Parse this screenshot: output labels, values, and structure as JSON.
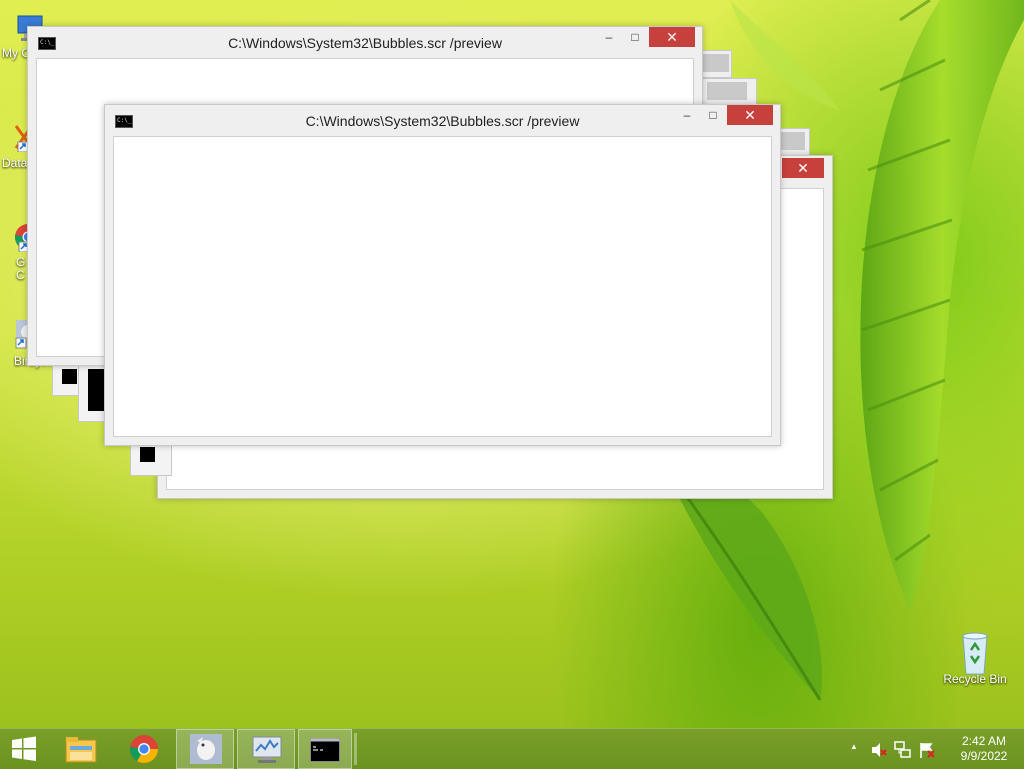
{
  "desktop": {
    "icons": [
      {
        "name": "my-computer",
        "label": "My C"
      },
      {
        "name": "data",
        "label": "Data"
      },
      {
        "name": "chrome",
        "label": "G"
      },
      {
        "name": "chrome-second-line",
        "label": "C"
      },
      {
        "name": "birdy",
        "label": "BirdyIn"
      },
      {
        "name": "recycle-bin",
        "label": "Recycle Bin"
      }
    ]
  },
  "windows": [
    {
      "title": "C:\\Windows\\System32\\Bubbles.scr /preview",
      "controls": {
        "minimize": "–",
        "maximize": "□",
        "close": "✕"
      }
    },
    {
      "title": "C:\\Windows\\System32\\Bubbles.scr /preview",
      "controls": {
        "minimize": "–",
        "maximize": "□",
        "close": "✕"
      }
    }
  ],
  "stub_controls": {
    "close": "✕"
  },
  "taskbar": {
    "items": [
      {
        "name": "start-button",
        "icon": "windows-logo-icon"
      },
      {
        "name": "file-explorer",
        "icon": "folder-icon"
      },
      {
        "name": "chrome",
        "icon": "chrome-icon"
      },
      {
        "name": "birdy-app",
        "icon": "bird-icon",
        "active": true
      },
      {
        "name": "task-manager",
        "icon": "monitor-chart-icon",
        "active": true
      },
      {
        "name": "command-prompt",
        "icon": "cmd-icon",
        "active": true
      }
    ],
    "tray": {
      "chevron": "▲",
      "clock_time": "2:42 AM",
      "clock_date": "9/9/2022"
    }
  },
  "colors": {
    "close_red": "#c7413c",
    "taskbar": "#7aa02a"
  }
}
